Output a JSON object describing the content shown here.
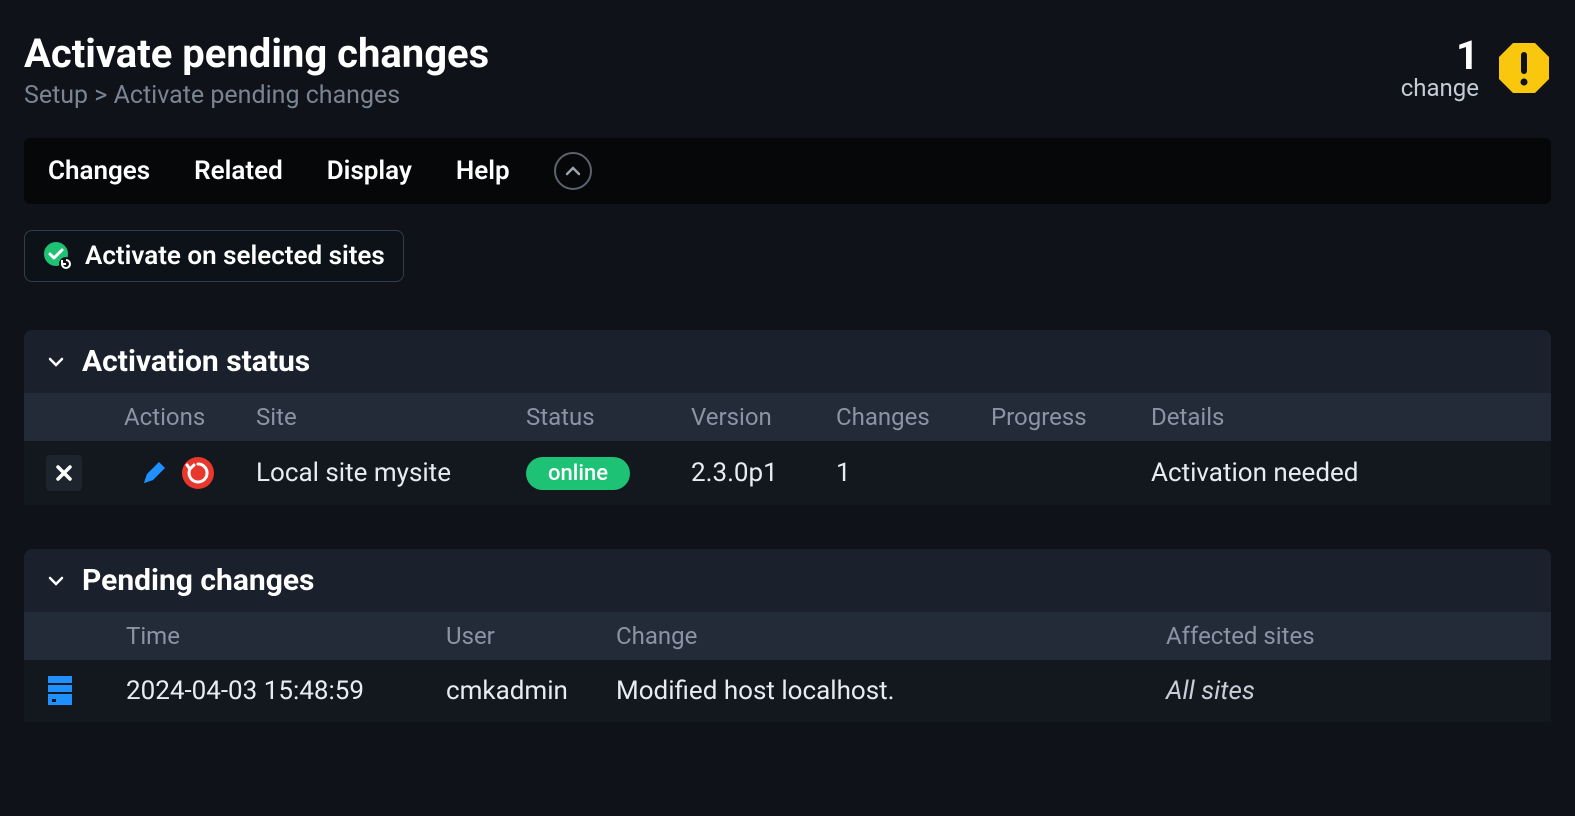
{
  "header": {
    "title": "Activate pending changes",
    "breadcrumb": "Setup > Activate pending changes",
    "change_count": "1",
    "change_label": "change"
  },
  "menu": {
    "items": [
      "Changes",
      "Related",
      "Display",
      "Help"
    ]
  },
  "actions": {
    "activate_label": "Activate on selected sites"
  },
  "activation": {
    "section_title": "Activation status",
    "columns": {
      "actions": "Actions",
      "site": "Site",
      "status": "Status",
      "version": "Version",
      "changes": "Changes",
      "progress": "Progress",
      "details": "Details"
    },
    "rows": [
      {
        "site": "Local site mysite",
        "status": "online",
        "version": "2.3.0p1",
        "changes": "1",
        "progress": "",
        "details": "Activation needed"
      }
    ]
  },
  "pending": {
    "section_title": "Pending changes",
    "columns": {
      "time": "Time",
      "user": "User",
      "change": "Change",
      "affected": "Affected sites"
    },
    "rows": [
      {
        "time": "2024-04-03 15:48:59",
        "user": "cmkadmin",
        "change": "Modified host localhost.",
        "affected": "All sites"
      }
    ]
  }
}
